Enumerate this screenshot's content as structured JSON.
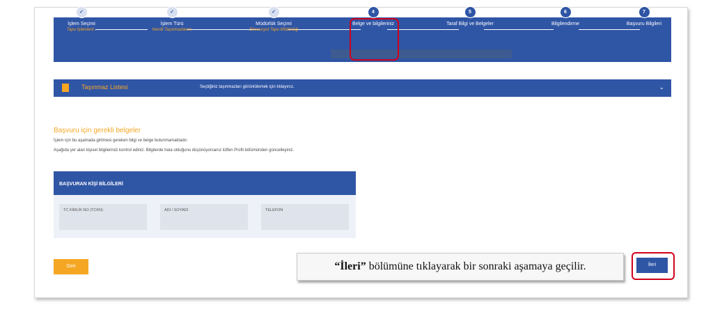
{
  "steps": [
    {
      "label": "İşlem Seçimi",
      "sub": "Tapu İşlemleri/..",
      "badge": "✓"
    },
    {
      "label": "İşlem Türü",
      "sub": "Kendi Taşınmazlarım",
      "badge": "✓"
    },
    {
      "label": "Müdürlük Seçimi",
      "sub": "Elmesoyut Tapu Müdürlüğ",
      "badge": "✓"
    },
    {
      "label": "Belge ve bilgileriniz",
      "sub": "",
      "badge": "4"
    },
    {
      "label": "Taraf Bilgi ve Belgeler",
      "sub": "",
      "badge": "5"
    },
    {
      "label": "Bilgilendirme",
      "sub": "",
      "badge": "6"
    },
    {
      "label": "Başvuru Bilgileri",
      "sub": "",
      "badge": "7"
    }
  ],
  "listbar": {
    "title": "Taşınmaz Listesi",
    "desc": "Seçtiğiniz taşınmazları görüntülemek için tıklayınız.",
    "chevron": "⌄"
  },
  "documents": {
    "title": "Başvuru için gerekli belgeler",
    "line1": "İşlem için bu aşamada girilmesi gereken bilgi ve belge bulunmamaktadır.",
    "line2": "Aşağıda yer alan kişisel bilgilerinizi kontrol ediniz. Bilgilerde hata olduğunu düşünüyorsanız lütfen Profil bölümünden güncelleyiniz."
  },
  "applicant": {
    "header": "BAŞVURAN KİŞİ BİLGİLERİ",
    "fields": [
      "TC KİMLİK NO (TCKN)",
      "ADI / SOYADI",
      "TELEFON"
    ]
  },
  "buttons": {
    "back": "Geri",
    "next": "İleri"
  },
  "callout": {
    "bold": "“İleri”",
    "rest": " bölümüne tıklayarak bir sonraki aşamaya geçilir."
  },
  "colors": {
    "primary": "#2f55a5",
    "accent": "#f5a623",
    "highlight": "#d0021b"
  }
}
